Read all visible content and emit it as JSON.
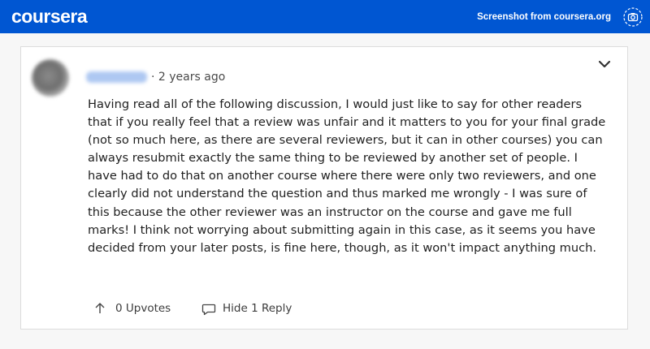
{
  "header": {
    "logo_text": "coursera",
    "source_label": "Screenshot from coursera.org",
    "background_color": "#0056d2",
    "camera_icon": "camera-icon"
  },
  "post": {
    "timestamp": "· 2 years ago",
    "menu_icon": "chevron-down-icon",
    "body": "Having read all of the following discussion, I would just like to say for other readers that if you really feel that a review was unfair and it matters to you for your final grade (not so much here, as there are several reviewers, but it can in other courses) you can always resubmit exactly the same thing to be reviewed by another set of people. I have had to do that on another course where there were only two reviewers, and one clearly did not understand the question and thus marked me wrongly - I was sure of this because the other reviewer was an instructor on the course and gave me full marks! I think not worrying about submitting again in this case, as it seems you have decided from your later posts, is fine here, though, as it won't impact anything much.",
    "upvotes_label": "0 Upvotes",
    "upvote_icon": "arrow-up-icon",
    "reply_label": "Hide 1 Reply",
    "reply_icon": "speech-bubble-icon"
  }
}
